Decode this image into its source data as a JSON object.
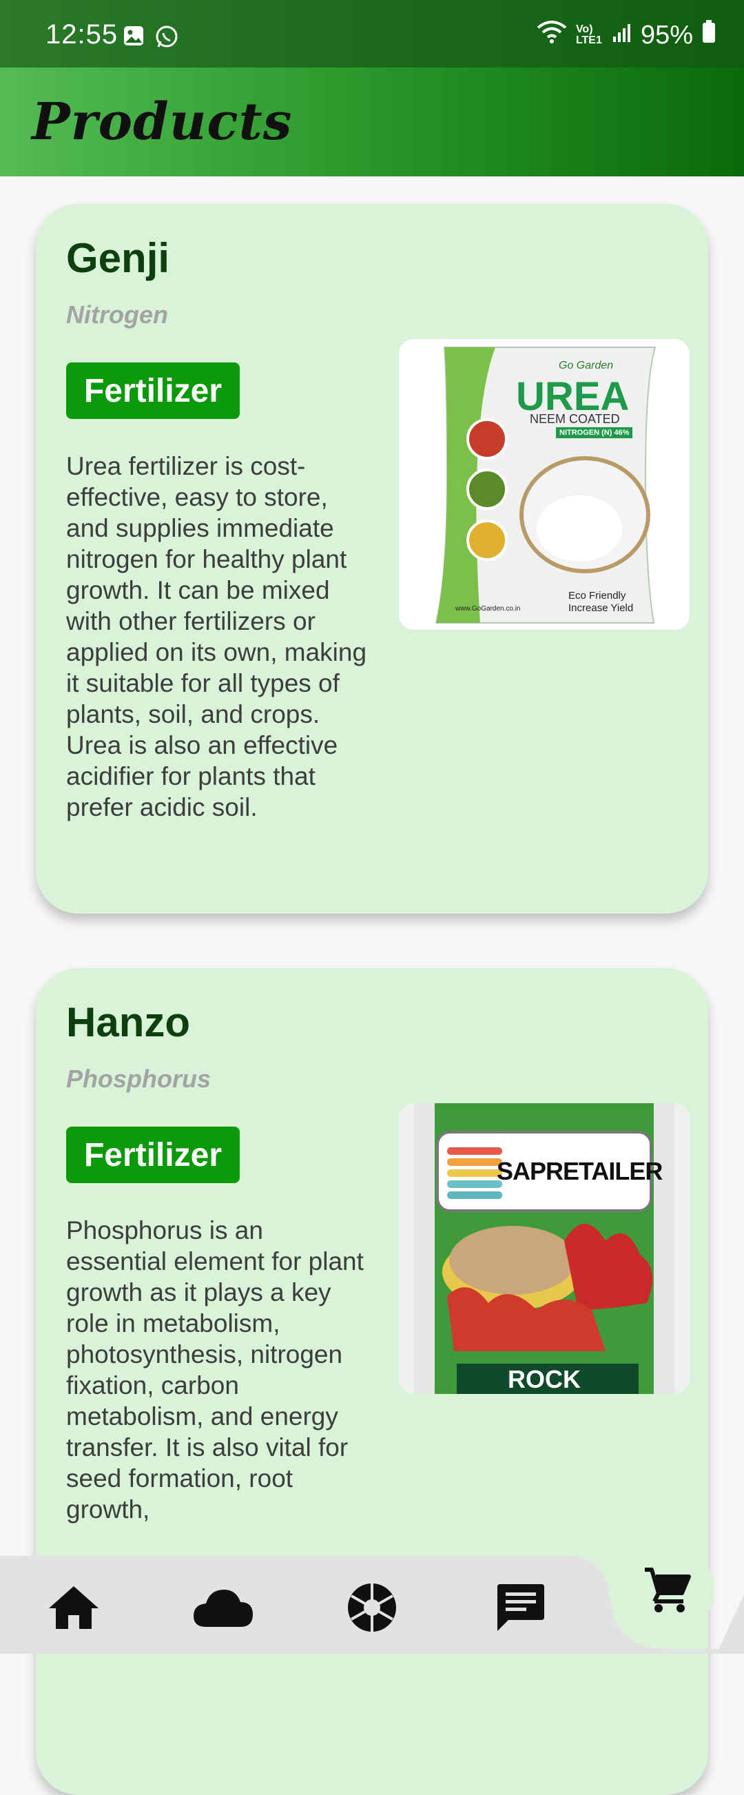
{
  "status_bar": {
    "time": "12:55",
    "left_icons": [
      "gallery-icon",
      "whatsapp-icon"
    ],
    "network": "Vo) LTE1",
    "battery": "95%"
  },
  "header": {
    "title": "Products"
  },
  "products": [
    {
      "name": "Genji",
      "nutrient": "Nitrogen",
      "category": "Fertilizer",
      "description": "Urea fertilizer is cost-effective, easy to store, and supplies immediate nitrogen for healthy plant growth. It can be mixed with other fertilizers or applied on its own, making it suitable for all types of plants, soil, and crops. Urea is also an effective acidifier for plants that prefer acidic soil.",
      "image": {
        "brand": "Go Garden",
        "title": "UREA",
        "line1": "NEEM COATED",
        "line2": "NITROGEN (N) 46%",
        "bullets": [
          "Eco Friendly",
          "Increase Yield"
        ],
        "footer": "www.GoGarden.co.in"
      }
    },
    {
      "name": "Hanzo",
      "nutrient": "Phosphorus",
      "category": "Fertilizer",
      "description": "Phosphorus is an essential element for plant growth as it plays a key role in metabolism, photosynthesis, nitrogen fixation, carbon metabolism, and energy transfer. It is also vital for seed formation, root growth,",
      "image": {
        "brand": "SAPRETAILER",
        "label": "ROCK"
      }
    }
  ],
  "bottom_nav": {
    "items": [
      "home-icon",
      "cloud-icon",
      "camera-aperture-icon",
      "chat-icon"
    ],
    "fab": "cart-icon"
  },
  "colors": {
    "header_green": "#2c9b2c",
    "card_bg": "#d8f3d8",
    "badge_green": "#0c990c",
    "title_dark_green": "#0e3f0e"
  }
}
